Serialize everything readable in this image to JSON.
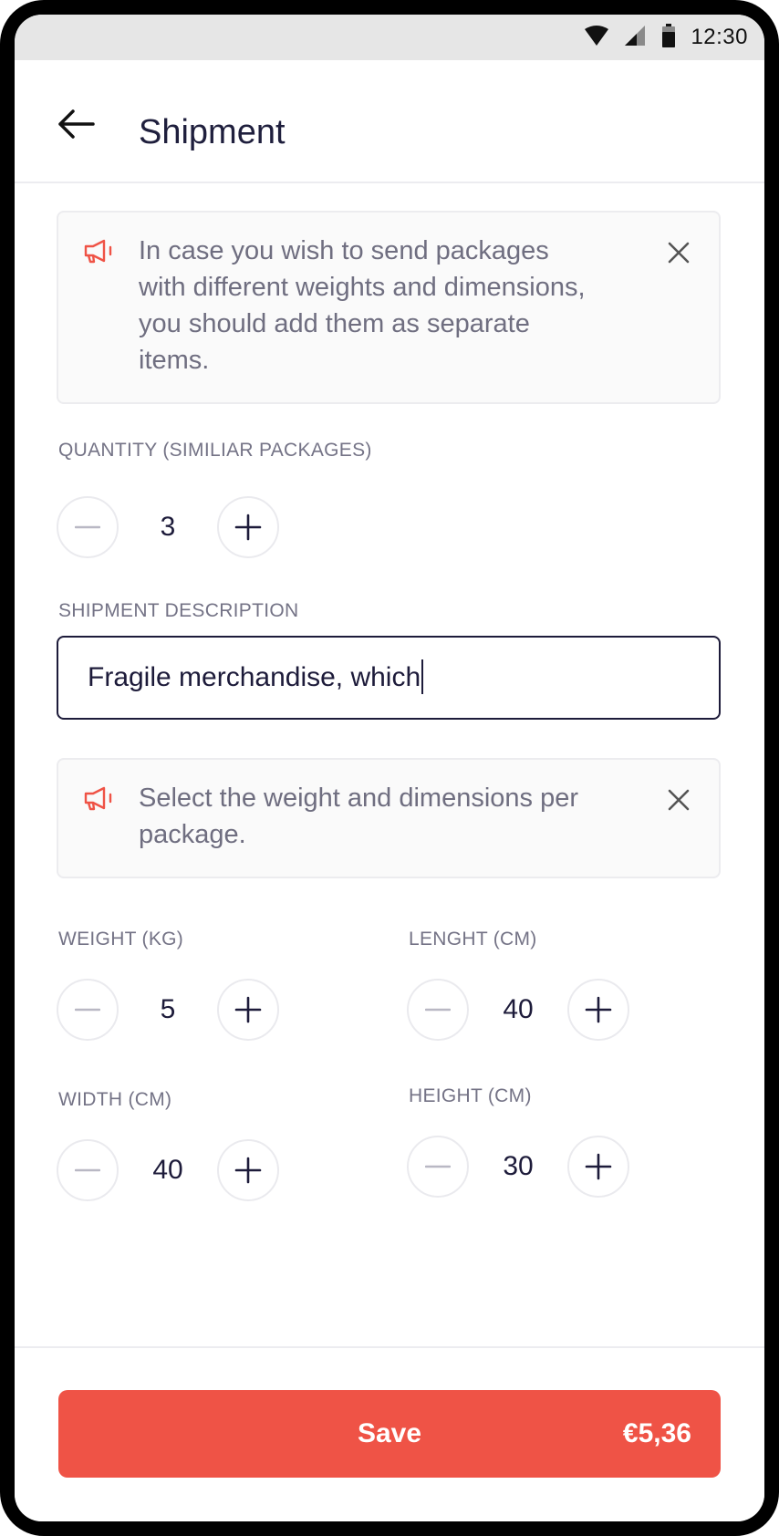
{
  "status_bar": {
    "time": "12:30",
    "icons": [
      "wifi-icon",
      "cellular-signal-icon",
      "battery-icon"
    ]
  },
  "app_bar": {
    "back_icon": "arrow-left-icon",
    "title": "Shipment"
  },
  "info_cards": [
    {
      "icon": "megaphone-icon",
      "lines": [
        "In case you wish to send packages",
        "with different weights and dimensions,",
        "you should add them as separate",
        "items."
      ],
      "close_icon": "close-icon"
    },
    {
      "icon": "megaphone-icon",
      "lines": [
        "Select the weight and dimensions per",
        "package."
      ],
      "close_icon": "close-icon"
    }
  ],
  "quantity": {
    "label": "QUANTITY (SIMILIAR PACKAGES)",
    "value": "3"
  },
  "description": {
    "label": "SHIPMENT DESCRIPTION",
    "value": "Fragile merchandise, which"
  },
  "dimensions": {
    "weight": {
      "label": "WEIGHT (KG)",
      "value": "5"
    },
    "length": {
      "label": "LENGHT (CM)",
      "value": "40"
    },
    "width": {
      "label": "WIDTH (CM)",
      "value": "40"
    },
    "height": {
      "label": "HEIGHT (CM)",
      "value": "30"
    }
  },
  "footer": {
    "save_label": "Save",
    "price": "€5,36"
  },
  "colors": {
    "accent": "#ef5346",
    "text_primary": "#1d1b3a",
    "text_secondary": "#747386",
    "card_bg": "#fafafa"
  }
}
